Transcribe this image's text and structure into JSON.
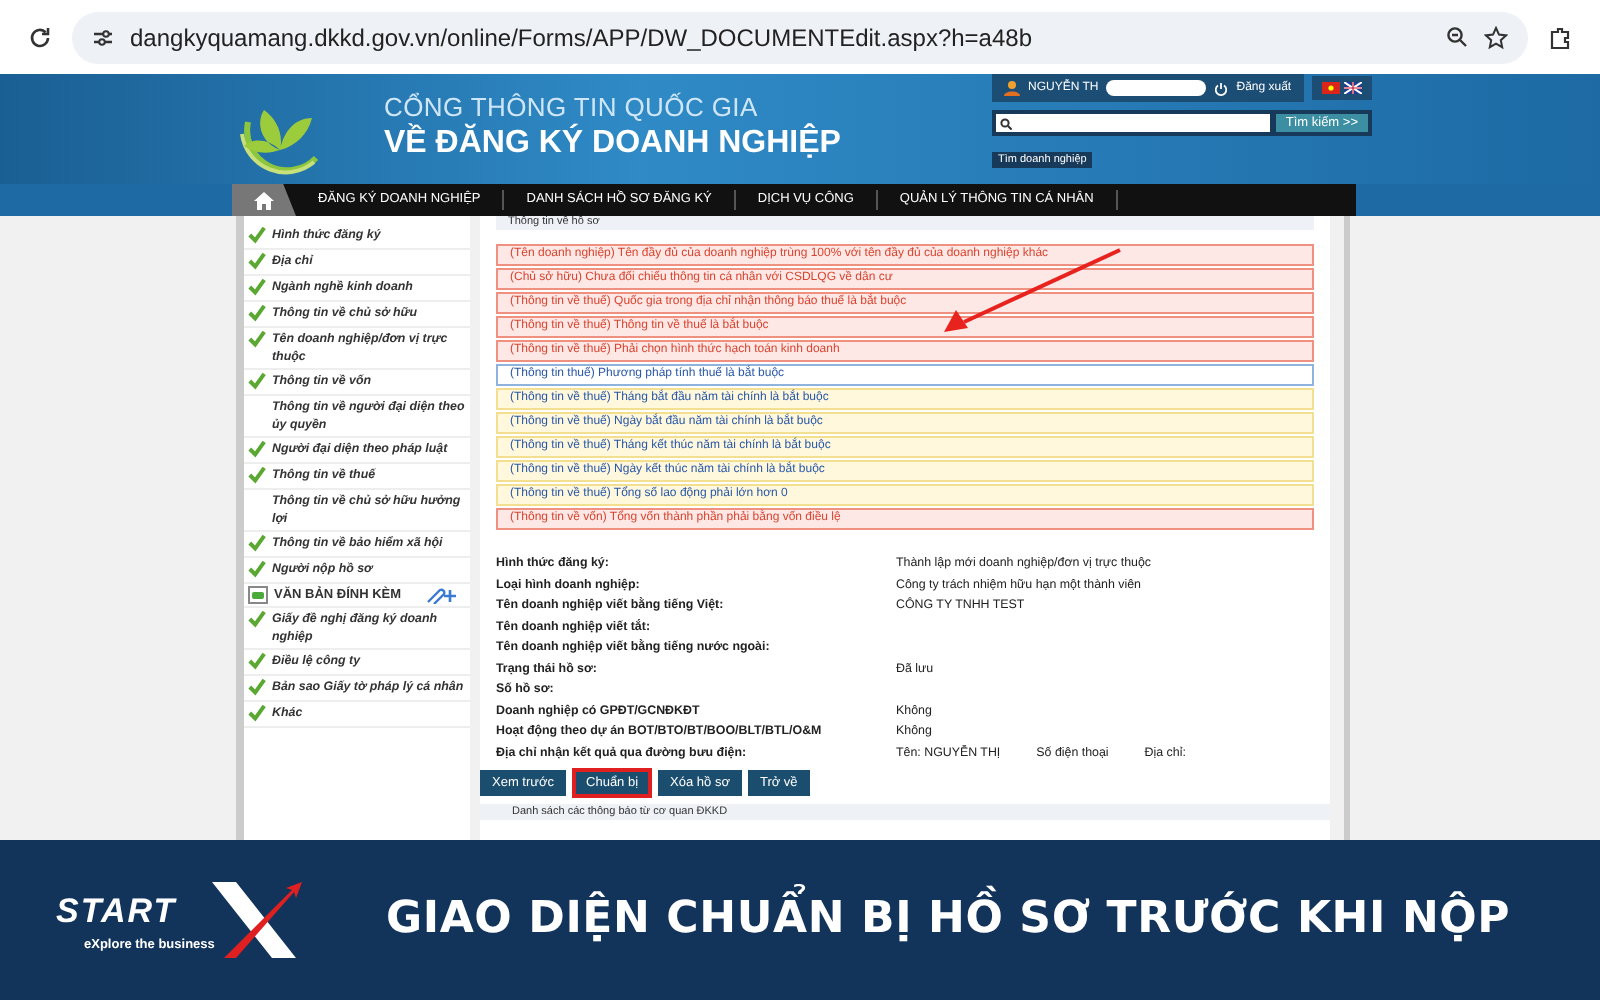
{
  "browser": {
    "url": "dangkyquamang.dkkd.gov.vn/online/Forms/APP/DW_DOCUMENTEdit.aspx?h=a48b"
  },
  "header": {
    "title_top": "CỔNG THÔNG TIN QUỐC GIA",
    "title_main": "VỀ ĐĂNG KÝ DOANH NGHIỆP",
    "user": "NGUYỄN TH",
    "logout": "Đăng xuất",
    "search_button": "Tìm kiếm >>",
    "search_link": "Tìm doanh nghiệp"
  },
  "nav": [
    "ĐĂNG KÝ DOANH NGHIỆP",
    "DANH SÁCH HỒ SƠ ĐĂNG KÝ",
    "DỊCH VỤ CÔNG",
    "QUẢN LÝ THÔNG TIN CÁ NHÂN"
  ],
  "sidebar": {
    "items": [
      {
        "kind": "item",
        "label": "Hình thức đăng ký",
        "checked": true
      },
      {
        "kind": "item",
        "label": "Địa chỉ",
        "checked": true
      },
      {
        "kind": "item",
        "label": "Ngành nghề kinh doanh",
        "checked": true
      },
      {
        "kind": "item",
        "label": "Thông tin về chủ sở hữu",
        "checked": true
      },
      {
        "kind": "item",
        "label": "Tên doanh nghiệp/đơn vị trực thuộc",
        "checked": true
      },
      {
        "kind": "item",
        "label": "Thông tin về vốn",
        "checked": true
      },
      {
        "kind": "item",
        "label": "Thông tin về người đại diện theo ủy quyền",
        "checked": false
      },
      {
        "kind": "item",
        "label": "Người đại diện theo pháp luật",
        "checked": true
      },
      {
        "kind": "item",
        "label": "Thông tin về thuế",
        "checked": true
      },
      {
        "kind": "item",
        "label": "Thông tin về chủ sở hữu hưởng lợi",
        "checked": false
      },
      {
        "kind": "item",
        "label": "Thông tin về bảo hiểm xã hội",
        "checked": true
      },
      {
        "kind": "item",
        "label": "Người nộp hồ sơ",
        "checked": true
      },
      {
        "kind": "section",
        "label": "VĂN BẢN ĐÍNH KÈM"
      },
      {
        "kind": "item",
        "label": "Giấy đề nghị đăng ký doanh nghiệp",
        "checked": true
      },
      {
        "kind": "item",
        "label": "Điều lệ công ty",
        "checked": true
      },
      {
        "kind": "item",
        "label": "Bản sao Giấy tờ pháp lý cá nhân",
        "checked": true
      },
      {
        "kind": "item",
        "label": "Khác",
        "checked": true
      }
    ]
  },
  "main": {
    "section_title": "Thông tin về hồ sơ",
    "messages": [
      {
        "kind": "error",
        "text": "(Tên doanh nghiệp) Tên đầy đủ của doanh nghiệp trùng 100% với tên đầy đủ của doanh nghiệp khác"
      },
      {
        "kind": "error",
        "text": "(Chủ sở hữu) Chưa đối chiếu thông tin cá nhân với CSDLQG về dân cư"
      },
      {
        "kind": "error",
        "text": "(Thông tin về thuế) Quốc gia trong địa chỉ nhận thông báo thuế là bắt buộc"
      },
      {
        "kind": "error",
        "text": "(Thông tin về thuế) Thông tin về thuế là bắt buộc"
      },
      {
        "kind": "error",
        "text": "(Thông tin về thuế) Phải chọn hình thức hạch toán kinh doanh"
      },
      {
        "kind": "info",
        "text": "(Thông tin thuế) Phương pháp tính thuế là bắt buộc"
      },
      {
        "kind": "warning",
        "text": "(Thông tin về thuế) Tháng bắt đầu năm tài chính là bắt buộc"
      },
      {
        "kind": "warning",
        "text": "(Thông tin về thuế) Ngày bắt đầu năm tài chính là bắt buộc"
      },
      {
        "kind": "warning",
        "text": "(Thông tin về thuế) Tháng kết thúc năm tài chính là bắt buộc"
      },
      {
        "kind": "warning",
        "text": "(Thông tin về thuế) Ngày kết thúc năm tài chính là bắt buộc"
      },
      {
        "kind": "warning",
        "text": "(Thông tin về thuế) Tổng số lao động phải lớn hơn 0"
      },
      {
        "kind": "error",
        "text": "(Thông tin về vốn) Tổng vốn thành phần phải bằng vốn điều lệ"
      }
    ],
    "fields": [
      {
        "label": "Hình thức đăng ký:",
        "value": "Thành lập mới doanh nghiệp/đơn vị trực thuộc"
      },
      {
        "label": "Loại hình doanh nghiệp:",
        "value": "Công ty trách nhiệm hữu hạn một thành viên"
      },
      {
        "label": "Tên doanh nghiệp viết bằng tiếng Việt:",
        "value": "CÔNG TY TNHH TEST"
      },
      {
        "label": "Tên doanh nghiệp viết tắt:"
      },
      {
        "label": "Tên doanh nghiệp viết bằng tiếng nước ngoài:"
      },
      {
        "label": "Trạng thái hồ sơ:",
        "value": "Đã lưu"
      },
      {
        "label": "Số hồ sơ:"
      },
      {
        "label": "Doanh nghiệp có GPĐT/GCNĐKĐT",
        "value": "Không"
      },
      {
        "label": "Hoạt động theo dự án BOT/BTO/BT/BOO/BLT/BTL/O&M",
        "value": "Không"
      },
      {
        "label": "Địa chỉ nhận kết quả qua đường bưu điện:",
        "value": "Tên: NGUYỄN THỊ",
        "value_2": "Số điện thoại",
        "value_3": "Địa chỉ:"
      }
    ],
    "buttons": [
      {
        "label": "Xem trước",
        "highlighted": false
      },
      {
        "label": "Chuẩn bị",
        "highlighted": true
      },
      {
        "label": "Xóa hồ sơ",
        "highlighted": false
      },
      {
        "label": "Trở về",
        "highlighted": false
      }
    ],
    "notice_title": "Danh sách các thông báo từ cơ quan ĐKKD"
  },
  "banner": {
    "brand": "START",
    "tagline": "eXplore the business",
    "title": "GIAO DIỆN CHUẨN BỊ HỒ SƠ TRƯỚC KHI NỘP"
  }
}
